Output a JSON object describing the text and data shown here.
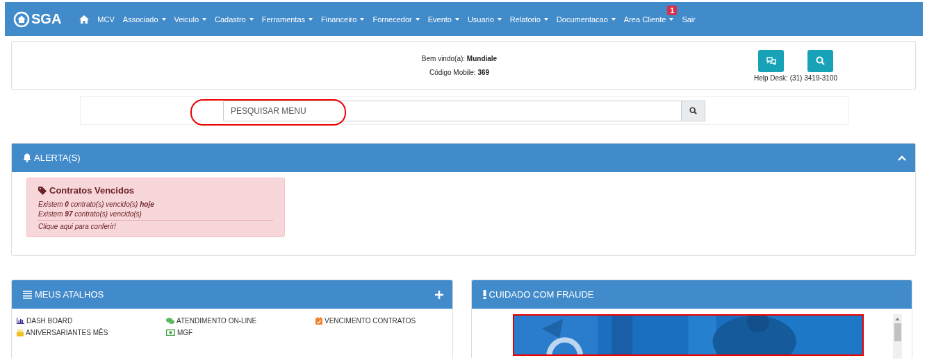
{
  "navbar": {
    "logo": "SGA",
    "items": [
      {
        "label": "MCV",
        "dropdown": false
      },
      {
        "label": "Associado",
        "dropdown": true
      },
      {
        "label": "Veiculo",
        "dropdown": true
      },
      {
        "label": "Cadastro",
        "dropdown": true
      },
      {
        "label": "Ferramentas",
        "dropdown": true
      },
      {
        "label": "Financeiro",
        "dropdown": true
      },
      {
        "label": "Fornecedor",
        "dropdown": true
      },
      {
        "label": "Evento",
        "dropdown": true
      },
      {
        "label": "Usuario",
        "dropdown": true
      },
      {
        "label": "Relatorio",
        "dropdown": true
      },
      {
        "label": "Documentacao",
        "dropdown": true
      },
      {
        "label": "Area Cliente",
        "dropdown": true,
        "badge": "1"
      },
      {
        "label": "Sair",
        "dropdown": false
      }
    ]
  },
  "welcome": {
    "greeting": "Bem vindo(a): **Mundiale**",
    "mobile_code": "Código Mobile: **369**",
    "help_desk": "Help Desk: (31) 3419-3100"
  },
  "search": {
    "placeholder": "PESQUISAR MENU"
  },
  "alerts": {
    "title": "ALERTA(S)",
    "expanded": true,
    "card": {
      "title": "Contratos Vencidos",
      "lines": [
        "Existem **0** contrato(s) vencido(s) **hoje**",
        "Existem **97** contrato(s) vencido(s)"
      ],
      "link": "Clique aqui para conferir!"
    }
  },
  "shortcuts": {
    "title": "MEUS ATALHOS",
    "items": [
      {
        "label": "DASH BOARD",
        "kind": "chart",
        "color": "#3a2a8c"
      },
      {
        "label": "ATENDIMENTO ON-LINE",
        "kind": "chat",
        "color": "#5cb85c"
      },
      {
        "label": "VENCIMENTO CONTRATOS",
        "kind": "calendar",
        "color": "#f0802a"
      },
      {
        "label": "ANIVERSARIANTES MÊS",
        "kind": "cake",
        "color": "#f0c020"
      },
      {
        "label": "MGF",
        "kind": "money",
        "color": "#3a9a3a"
      }
    ]
  },
  "fraud": {
    "title": "CUIDADO COM FRAUDE"
  }
}
